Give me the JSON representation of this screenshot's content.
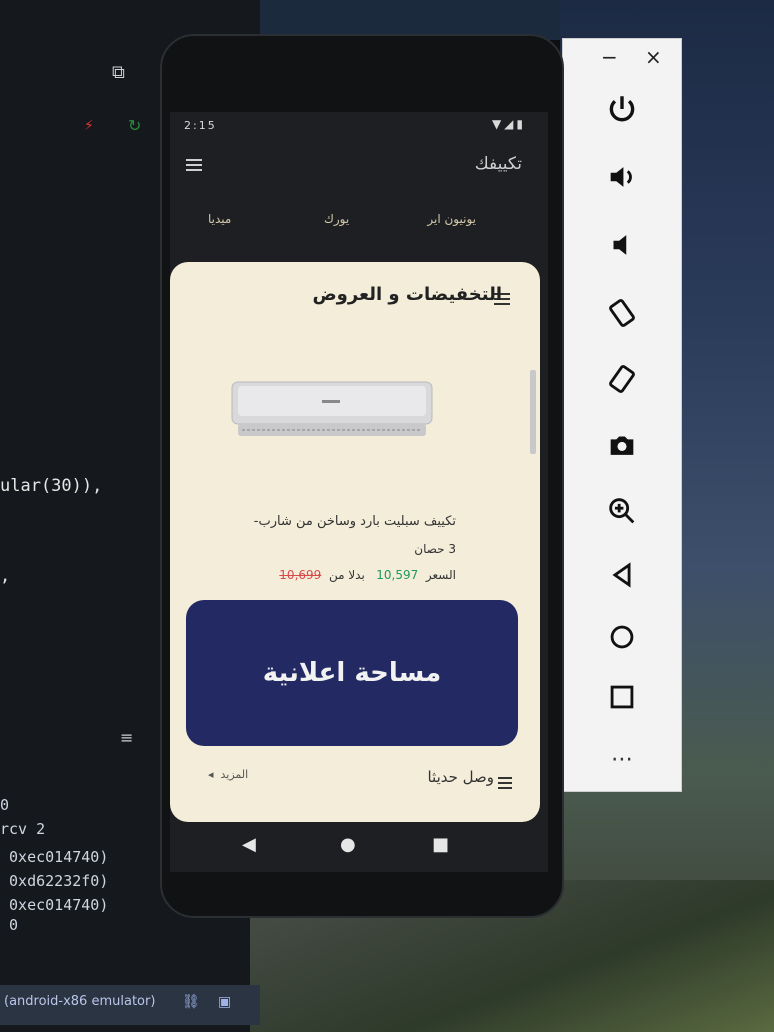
{
  "ide": {
    "code_lines": [
      "ular(30)),",
      ","
    ],
    "terminal_lines": [
      "0",
      "rcv 2",
      " 0xec014740)",
      " 0xd62232f0)",
      " 0xec014740)",
      " 0"
    ],
    "status": "(android-x86 emulator)"
  },
  "emulator_toolbar": {
    "minimize": "−",
    "close": "×",
    "buttons": [
      "power-icon",
      "volume-up-icon",
      "volume-down-icon",
      "rotate-left-icon",
      "rotate-right-icon",
      "camera-icon",
      "zoom-icon",
      "back-icon",
      "home-icon",
      "overview-icon",
      "more-icon"
    ],
    "more": "⋯"
  },
  "phone": {
    "status_time": "2:15",
    "app_title": "تكييفك",
    "tabs": [
      "يونيون اير",
      "يورك",
      "ميديا"
    ],
    "section_title": "التخفيضات و العروض",
    "product": {
      "name": "تكييف سبليت بارد وساخن من شارب-",
      "qty": "3 حصان",
      "price_label": "السعر",
      "price_now": "10,597",
      "instead_label": "بدلا من",
      "price_old": "10,699"
    },
    "ad_banner": "مساحة اعلانية",
    "recent_label": "وصل حديثا",
    "more_link": "المزيد"
  },
  "colors": {
    "card_bg": "#f3edd9",
    "ad_bg": "#232a63",
    "price_now": "#1e9b55",
    "price_old": "#d84a4a"
  }
}
